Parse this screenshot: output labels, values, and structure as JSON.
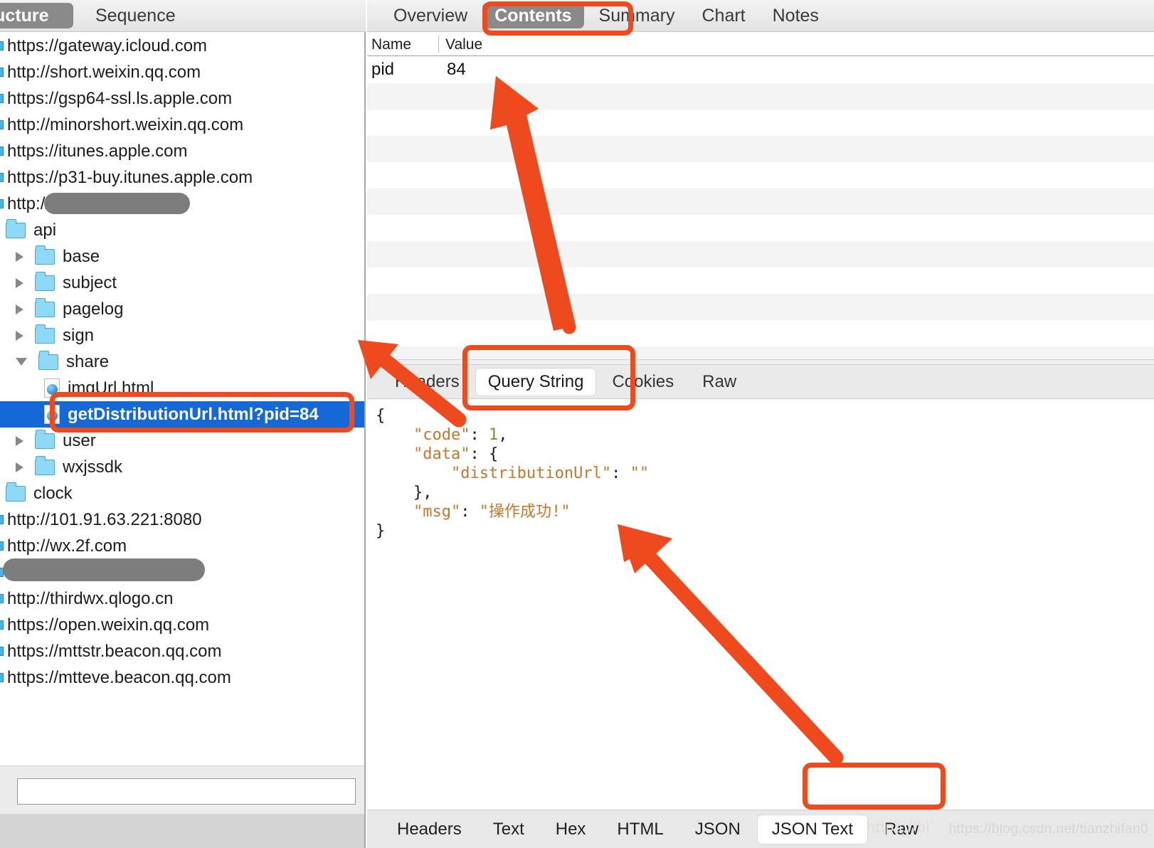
{
  "left_panel": {
    "tabs": [
      {
        "label": "ructure",
        "selected": true
      },
      {
        "label": "Sequence",
        "selected": false
      }
    ],
    "tree": [
      {
        "type": "host",
        "label": "https://gateway.icloud.com",
        "indent": 0
      },
      {
        "type": "host",
        "label": "http://short.weixin.qq.com",
        "indent": 0
      },
      {
        "type": "host",
        "label": "https://gsp64-ssl.ls.apple.com",
        "indent": 0
      },
      {
        "type": "host",
        "label": "http://minorshort.weixin.qq.com",
        "indent": 0
      },
      {
        "type": "host",
        "label": "https://itunes.apple.com",
        "indent": 0
      },
      {
        "type": "host",
        "label": "https://p31-buy.itunes.apple.com",
        "indent": 0
      },
      {
        "type": "host-redacted",
        "label": "http://",
        "indent": 0
      },
      {
        "type": "folder",
        "label": "api",
        "indent": 1,
        "twisty": "none"
      },
      {
        "type": "folder",
        "label": "base",
        "indent": 2,
        "twisty": "closed"
      },
      {
        "type": "folder",
        "label": "subject",
        "indent": 2,
        "twisty": "closed"
      },
      {
        "type": "folder",
        "label": "pagelog",
        "indent": 2,
        "twisty": "closed"
      },
      {
        "type": "folder",
        "label": "sign",
        "indent": 2,
        "twisty": "closed"
      },
      {
        "type": "folder",
        "label": "share",
        "indent": 2,
        "twisty": "open"
      },
      {
        "type": "doc",
        "label": "imgUrl.html",
        "indent": 3
      },
      {
        "type": "doc",
        "label": "getDistributionUrl.html?pid=84",
        "indent": 3,
        "selected": true
      },
      {
        "type": "folder",
        "label": "user",
        "indent": 2,
        "twisty": "closed"
      },
      {
        "type": "folder",
        "label": "wxjssdk",
        "indent": 2,
        "twisty": "closed"
      },
      {
        "type": "folder",
        "label": "clock",
        "indent": 1,
        "twisty": "none"
      },
      {
        "type": "host",
        "label": "http://101.91.63.221:8080",
        "indent": 0
      },
      {
        "type": "host",
        "label": "http://wx.2f.com",
        "indent": 0
      },
      {
        "type": "host-redacted",
        "label": "",
        "indent": 0
      },
      {
        "type": "host",
        "label": "http://thirdwx.qlogo.cn",
        "indent": 0
      },
      {
        "type": "host",
        "label": "https://open.weixin.qq.com",
        "indent": 0
      },
      {
        "type": "host",
        "label": "https://mttstr.beacon.qq.com",
        "indent": 0
      },
      {
        "type": "host",
        "label": "https://mtteve.beacon.qq.com",
        "indent": 0
      }
    ],
    "filter": {
      "label": ":",
      "value": "",
      "placeholder": ""
    }
  },
  "right_panel": {
    "top_tabs": [
      {
        "label": "Overview",
        "selected": false
      },
      {
        "label": "Contents",
        "selected": true
      },
      {
        "label": "Summary",
        "selected": false
      },
      {
        "label": "Chart",
        "selected": false
      },
      {
        "label": "Notes",
        "selected": false
      }
    ],
    "table": {
      "columns": [
        "Name",
        "Value"
      ],
      "rows": [
        {
          "name": "pid",
          "value": "84"
        }
      ],
      "empty_row_count": 11
    },
    "mid_tabs": [
      {
        "label": "Headers",
        "selected": false
      },
      {
        "label": "Query String",
        "selected": true
      },
      {
        "label": "Cookies",
        "selected": false
      },
      {
        "label": "Raw",
        "selected": false
      }
    ],
    "json_body": {
      "lines": [
        [
          {
            "t": "{",
            "c": "jbrace"
          }
        ],
        [
          {
            "t": "    ",
            "c": "jpunc"
          },
          {
            "t": "\"code\"",
            "c": "jkey"
          },
          {
            "t": ": ",
            "c": "jpunc"
          },
          {
            "t": "1",
            "c": "jnum"
          },
          {
            "t": ",",
            "c": "jpunc"
          }
        ],
        [
          {
            "t": "    ",
            "c": "jpunc"
          },
          {
            "t": "\"data\"",
            "c": "jkey"
          },
          {
            "t": ": ",
            "c": "jpunc"
          },
          {
            "t": "{",
            "c": "jbrace"
          }
        ],
        [
          {
            "t": "        ",
            "c": "jpunc"
          },
          {
            "t": "\"distributionUrl\"",
            "c": "jkey"
          },
          {
            "t": ": ",
            "c": "jpunc"
          },
          {
            "t": "\"\"",
            "c": "jstr"
          }
        ],
        [
          {
            "t": "    ",
            "c": "jpunc"
          },
          {
            "t": "}",
            "c": "jbrace"
          },
          {
            "t": ",",
            "c": "jpunc"
          }
        ],
        [
          {
            "t": "    ",
            "c": "jpunc"
          },
          {
            "t": "\"msg\"",
            "c": "jkey"
          },
          {
            "t": ": ",
            "c": "jpunc"
          },
          {
            "t": "\"操作成功!\"",
            "c": "jstr"
          }
        ],
        [
          {
            "t": "}",
            "c": "jbrace"
          }
        ]
      ]
    },
    "bottom_tabs": [
      {
        "label": "Headers",
        "selected": false
      },
      {
        "label": "Text",
        "selected": false
      },
      {
        "label": "Hex",
        "selected": false
      },
      {
        "label": "HTML",
        "selected": false
      },
      {
        "label": "JSON",
        "selected": false
      },
      {
        "label": "JSON Text",
        "selected": true
      },
      {
        "label": "Raw",
        "selected": false
      }
    ]
  },
  "watermark": {
    "faint": "https://blog.csdn.net/tianzhifan0",
    "ghost": "https://bl"
  },
  "annotations": {
    "accent_color": "#EF4A1E",
    "highlights": [
      {
        "name": "contents-tab-highlight"
      },
      {
        "name": "query-string-tab-highlight"
      },
      {
        "name": "json-text-tab-highlight"
      },
      {
        "name": "selected-request-highlight"
      }
    ],
    "arrows": [
      {
        "name": "arrow-to-table",
        "from": "table-area"
      },
      {
        "name": "arrow-to-selected-request",
        "from": "query-string-tab"
      },
      {
        "name": "arrow-to-json-text-tab",
        "from": "json-body"
      }
    ]
  }
}
